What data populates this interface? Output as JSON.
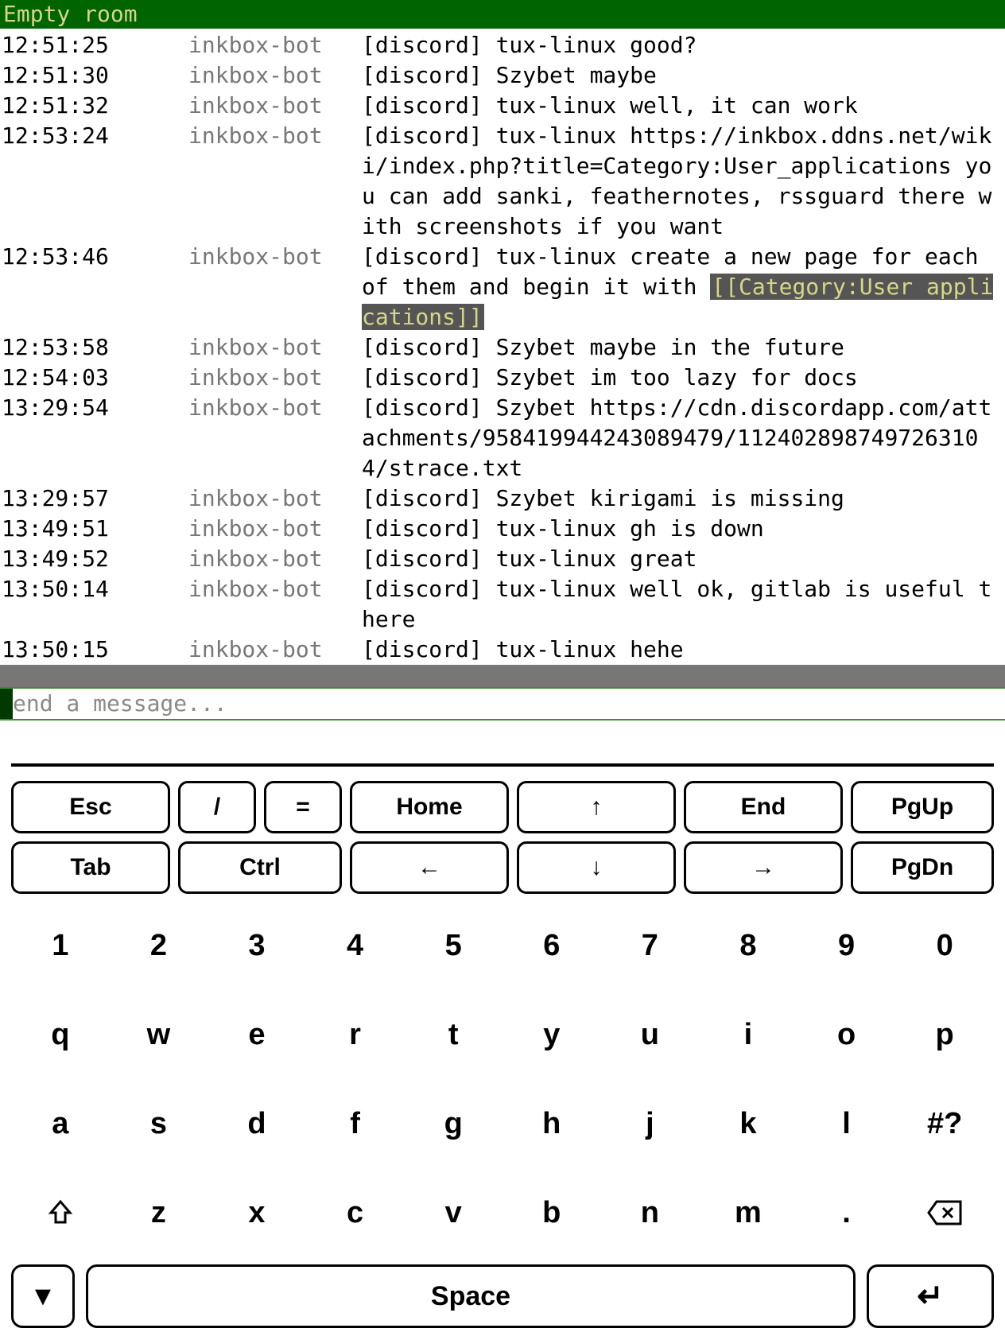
{
  "title": "Empty room",
  "messages": [
    {
      "time": "12:51:25",
      "user": "inkbox-bot",
      "text": "[discord] tux-linux good?",
      "highlight": ""
    },
    {
      "time": "12:51:30",
      "user": "inkbox-bot",
      "text": "[discord] Szybet maybe",
      "highlight": ""
    },
    {
      "time": "12:51:32",
      "user": "inkbox-bot",
      "text": "[discord] tux-linux well, it can work",
      "highlight": ""
    },
    {
      "time": "12:53:24",
      "user": "inkbox-bot",
      "text": "[discord] tux-linux https://inkbox.ddns.net/wiki/index.php?title=Category:User_applications you can add sanki, feathernotes, rssguard there with screenshots if you want",
      "highlight": ""
    },
    {
      "time": "12:53:46",
      "user": "inkbox-bot",
      "text": "[discord] tux-linux create a new page for each of them and begin it with ",
      "highlight": "[[Category:User applications]]"
    },
    {
      "time": "12:53:58",
      "user": "inkbox-bot",
      "text": "[discord] Szybet maybe in the future",
      "highlight": ""
    },
    {
      "time": "12:54:03",
      "user": "inkbox-bot",
      "text": "[discord] Szybet im too lazy for docs",
      "highlight": ""
    },
    {
      "time": "13:29:54",
      "user": "inkbox-bot",
      "text": "[discord] Szybet https://cdn.discordapp.com/attachments/958419944243089479/1124028987497263104/strace.txt",
      "highlight": ""
    },
    {
      "time": "13:29:57",
      "user": "inkbox-bot",
      "text": "[discord] Szybet kirigami is missing",
      "highlight": ""
    },
    {
      "time": "13:49:51",
      "user": "inkbox-bot",
      "text": "[discord] tux-linux gh is down",
      "highlight": ""
    },
    {
      "time": "13:49:52",
      "user": "inkbox-bot",
      "text": "[discord] tux-linux great",
      "highlight": ""
    },
    {
      "time": "13:50:14",
      "user": "inkbox-bot",
      "text": "[discord] tux-linux well ok, gitlab is useful there",
      "highlight": ""
    },
    {
      "time": "13:50:15",
      "user": "inkbox-bot",
      "text": "[discord] tux-linux hehe",
      "highlight": ""
    }
  ],
  "input": {
    "placeholder": "end a message..."
  },
  "keyboard": {
    "fn_row1": {
      "esc": "Esc",
      "slash": "/",
      "eq": "=",
      "home": "Home",
      "up": "↑",
      "end": "End",
      "pgup": "PgUp"
    },
    "fn_row2": {
      "tab": "Tab",
      "ctrl": "Ctrl",
      "left": "←",
      "down": "↓",
      "right": "→",
      "pgdn": "PgDn"
    },
    "row_num": [
      "1",
      "2",
      "3",
      "4",
      "5",
      "6",
      "7",
      "8",
      "9",
      "0"
    ],
    "row_q": [
      "q",
      "w",
      "e",
      "r",
      "t",
      "y",
      "u",
      "i",
      "o",
      "p"
    ],
    "row_a": [
      "a",
      "s",
      "d",
      "f",
      "g",
      "h",
      "j",
      "k",
      "l",
      "#?"
    ],
    "row_z": [
      "⇧",
      "z",
      "x",
      "c",
      "v",
      "b",
      "n",
      "m",
      ".",
      "⌫"
    ],
    "bottom": {
      "hide": "▼",
      "space": "Space",
      "enter": "↵"
    }
  }
}
